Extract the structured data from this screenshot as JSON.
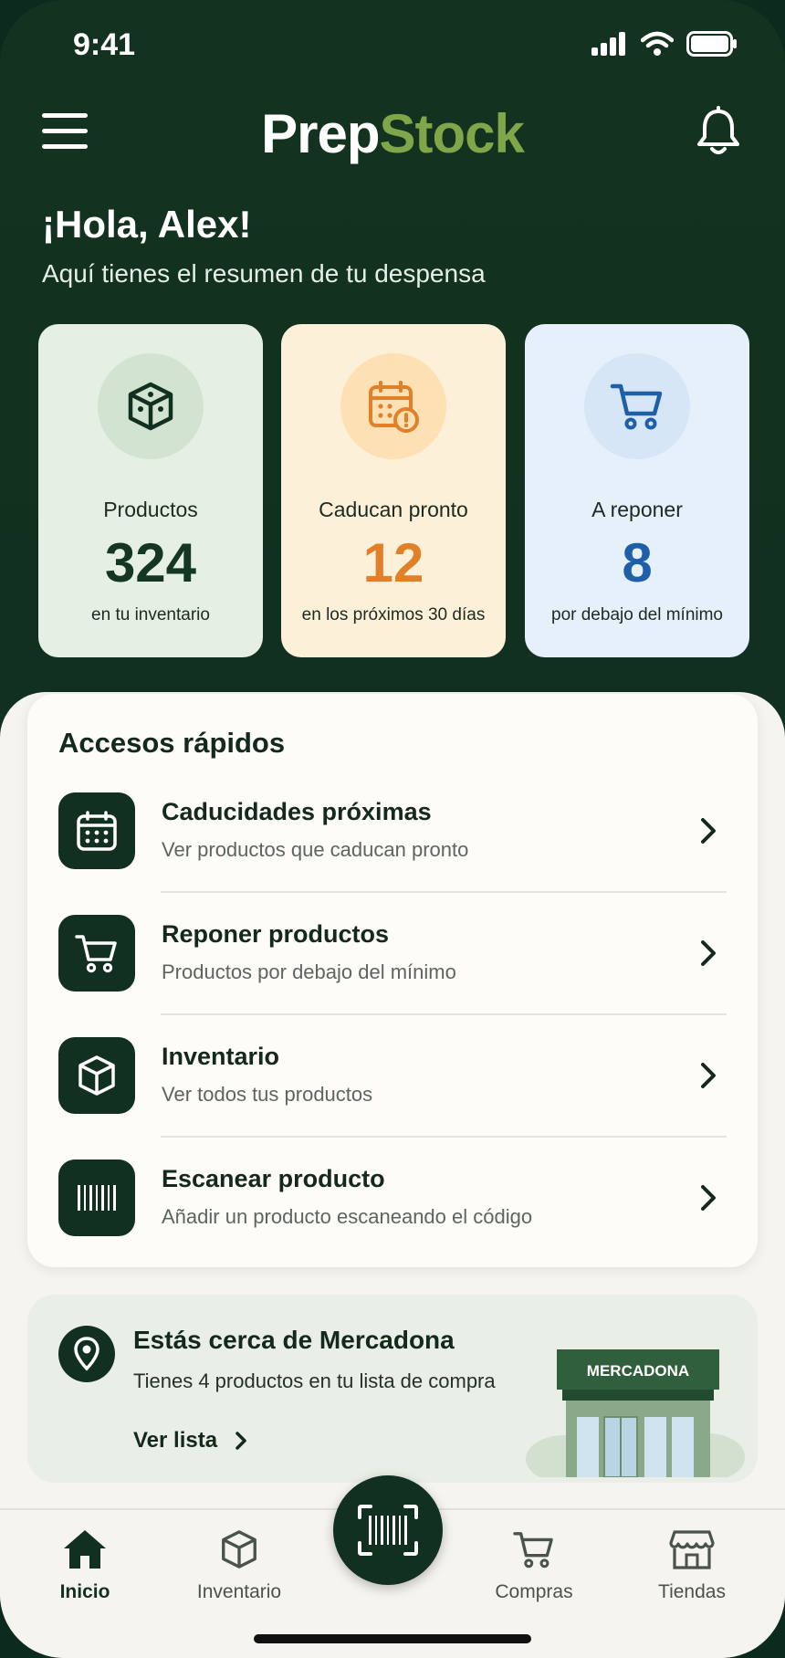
{
  "status_bar": {
    "time": "9:41"
  },
  "header": {
    "brand_part1": "Prep",
    "brand_part2": "Stock"
  },
  "greeting": {
    "title": "¡Hola, Alex!",
    "subtitle": "Aquí tienes el resumen de tu despensa"
  },
  "stats": [
    {
      "label": "Productos",
      "value": "324",
      "sub": "en tu inventario",
      "icon": "box-icon"
    },
    {
      "label": "Caducan pronto",
      "value": "12",
      "sub": "en los próximos 30 días",
      "icon": "calendar-warning-icon"
    },
    {
      "label": "A reponer",
      "value": "8",
      "sub": "por debajo del mínimo",
      "icon": "cart-icon"
    }
  ],
  "quick_access": {
    "title": "Accesos rápidos",
    "items": [
      {
        "title": "Caducidades próximas",
        "sub": "Ver productos que caducan pronto",
        "icon": "calendar-icon"
      },
      {
        "title": "Reponer productos",
        "sub": "Productos por debajo del mínimo",
        "icon": "cart-icon"
      },
      {
        "title": "Inventario",
        "sub": "Ver todos tus productos",
        "icon": "box-icon"
      },
      {
        "title": "Escanear producto",
        "sub": "Añadir un producto escaneando el código",
        "icon": "barcode-icon"
      }
    ]
  },
  "location": {
    "title": "Estás cerca de Mercadona",
    "sub": "Tienes 4 productos en tu lista de compra",
    "link": "Ver lista",
    "store_name": "MERCADONA"
  },
  "tabbar": {
    "items": [
      {
        "label": "Inicio",
        "active": true
      },
      {
        "label": "Inventario",
        "active": false
      },
      {
        "label": "Compras",
        "active": false
      },
      {
        "label": "Tiendas",
        "active": false
      }
    ]
  },
  "colors": {
    "brand_dark": "#12301f",
    "brand_green": "#7fa74a",
    "warning_orange": "#e0812a",
    "info_blue": "#1f5fa8"
  }
}
